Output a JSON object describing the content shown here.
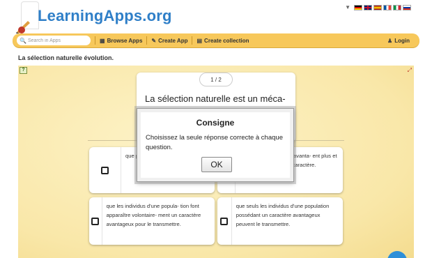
{
  "header": {
    "logo_text": "LearningApps.org",
    "languages": [
      {
        "code": "de",
        "colors": [
          "#000000",
          "#dd0000",
          "#ffce00"
        ]
      },
      {
        "code": "en",
        "colors": [
          "#012169",
          "#ffffff",
          "#c8102e"
        ]
      },
      {
        "code": "es",
        "colors": [
          "#aa151b",
          "#f1bf00",
          "#aa151b"
        ]
      },
      {
        "code": "fr",
        "colors": [
          "#0055a4",
          "#ffffff",
          "#ef4135"
        ]
      },
      {
        "code": "it",
        "colors": [
          "#009246",
          "#ffffff",
          "#ce2b37"
        ]
      },
      {
        "code": "ru",
        "colors": [
          "#ffffff",
          "#0039a6",
          "#d52b1e"
        ]
      }
    ]
  },
  "toolbar": {
    "search_placeholder": "Search in Apps",
    "browse_label": "Browse Apps",
    "create_label": "Create App",
    "collection_label": "Create collection",
    "login_label": "Login",
    "accent_color": "#f7c85b"
  },
  "page": {
    "title": "La sélection naturelle évolution."
  },
  "app": {
    "counter": "1 / 2",
    "question": "La sélection naturelle est un méca-",
    "answers": [
      {
        "text": "que pula cara le transmettre."
      },
      {
        "text": "d'une population ctère avanta- ent plus et trans- mettent plus ce caractère."
      },
      {
        "text": "que les individus d'une popula- tion font apparaître volontaire- ment un caractère avantageux pour le transmettre."
      },
      {
        "text": "que seuls les individus d'une population possédant un caractère avantageux peuvent le transmettre."
      }
    ]
  },
  "modal": {
    "title": "Consigne",
    "text": "Choisissez la seule réponse correcte à chaque question.",
    "ok_label": "OK"
  }
}
